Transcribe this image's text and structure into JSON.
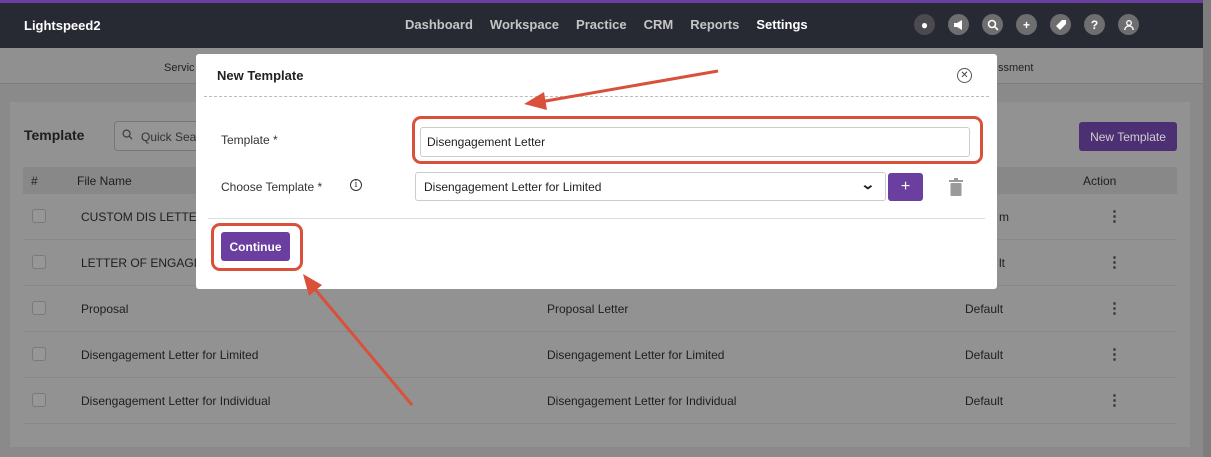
{
  "topbar": {
    "brand": "Lightspeed2",
    "nav": [
      {
        "label": "Dashboard",
        "active": false
      },
      {
        "label": "Workspace",
        "active": false
      },
      {
        "label": "Practice",
        "active": false
      },
      {
        "label": "CRM",
        "active": false
      },
      {
        "label": "Reports",
        "active": false
      },
      {
        "label": "Settings",
        "active": true
      }
    ],
    "icons": [
      "status-icon",
      "megaphone-icon",
      "search-icon",
      "add-icon",
      "tag-icon",
      "help-icon",
      "user-icon"
    ]
  },
  "subnav": {
    "left_fragment": "Servic",
    "right_fragment": "ssment"
  },
  "page": {
    "title": "Template",
    "search_placeholder": "Quick Sea",
    "new_template_label": "New Template",
    "columns": {
      "index": "#",
      "file_name": "File Name",
      "action": "Action"
    },
    "rows": [
      {
        "file_name": "CUSTOM DIS LETTE",
        "template": "",
        "type": "m"
      },
      {
        "file_name": "LETTER OF ENGAGI",
        "template": "",
        "type": "lt"
      },
      {
        "file_name": "Proposal",
        "template": "Proposal Letter",
        "type": "Default"
      },
      {
        "file_name": "Disengagement Letter for Limited",
        "template": "Disengagement Letter for Limited",
        "type": "Default"
      },
      {
        "file_name": "Disengagement Letter for Individual",
        "template": "Disengagement Letter for Individual",
        "type": "Default"
      }
    ]
  },
  "modal": {
    "title": "New Template",
    "template_label": "Template *",
    "template_value": "Disengagement Letter",
    "choose_label": "Choose Template *",
    "choose_value": "Disengagement Letter for Limited",
    "add_symbol": "+",
    "continue_label": "Continue"
  },
  "colors": {
    "accent": "#6b3fa0",
    "annotation": "#d9513a",
    "topbar": "#272a33"
  }
}
